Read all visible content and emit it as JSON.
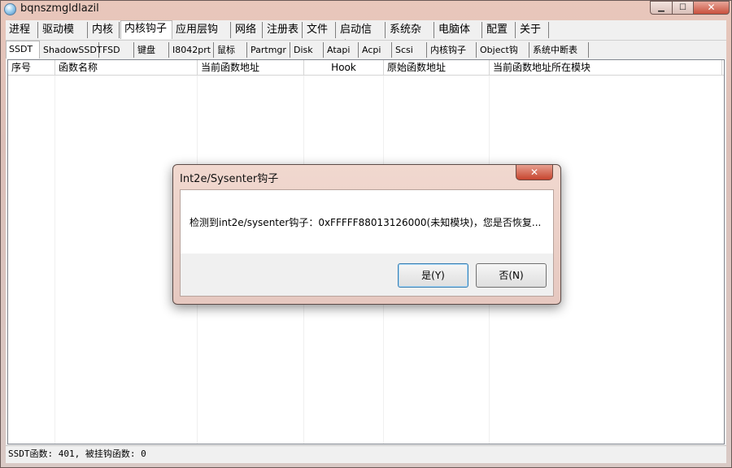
{
  "window": {
    "title": "bqnszmgldlazil"
  },
  "tabs_main": [
    "进程",
    "驱动模块",
    "内核",
    "内核钩子",
    "应用层钩子",
    "网络",
    "注册表",
    "文件",
    "启动信息",
    "系统杂项",
    "电脑体检",
    "配置",
    "关于"
  ],
  "tabs_sub": [
    "SSDT",
    "ShadowSSDT",
    "FSD",
    "键盘",
    "I8042prt",
    "鼠标",
    "Partmgr",
    "Disk",
    "Atapi",
    "Acpi",
    "Scsi",
    "内核钩子",
    "Object钩子",
    "系统中断表"
  ],
  "table": {
    "columns": [
      "序号",
      "函数名称",
      "当前函数地址",
      "Hook",
      "原始函数地址",
      "当前函数地址所在模块"
    ]
  },
  "status": {
    "text": "SSDT函数: 401, 被挂钩函数: 0"
  },
  "dialog": {
    "title": "Int2e/Sysenter钩子",
    "message": "检测到int2e/sysenter钩子：0xFFFFF88013126000(未知模块)，您是否恢复...",
    "yes_label": "是(Y)",
    "no_label": "否(N)",
    "close_glyph": "✕"
  },
  "colors": {
    "frame": "#dcbfb8",
    "close": "#c7452f",
    "default_button": "#3c7fb1"
  }
}
